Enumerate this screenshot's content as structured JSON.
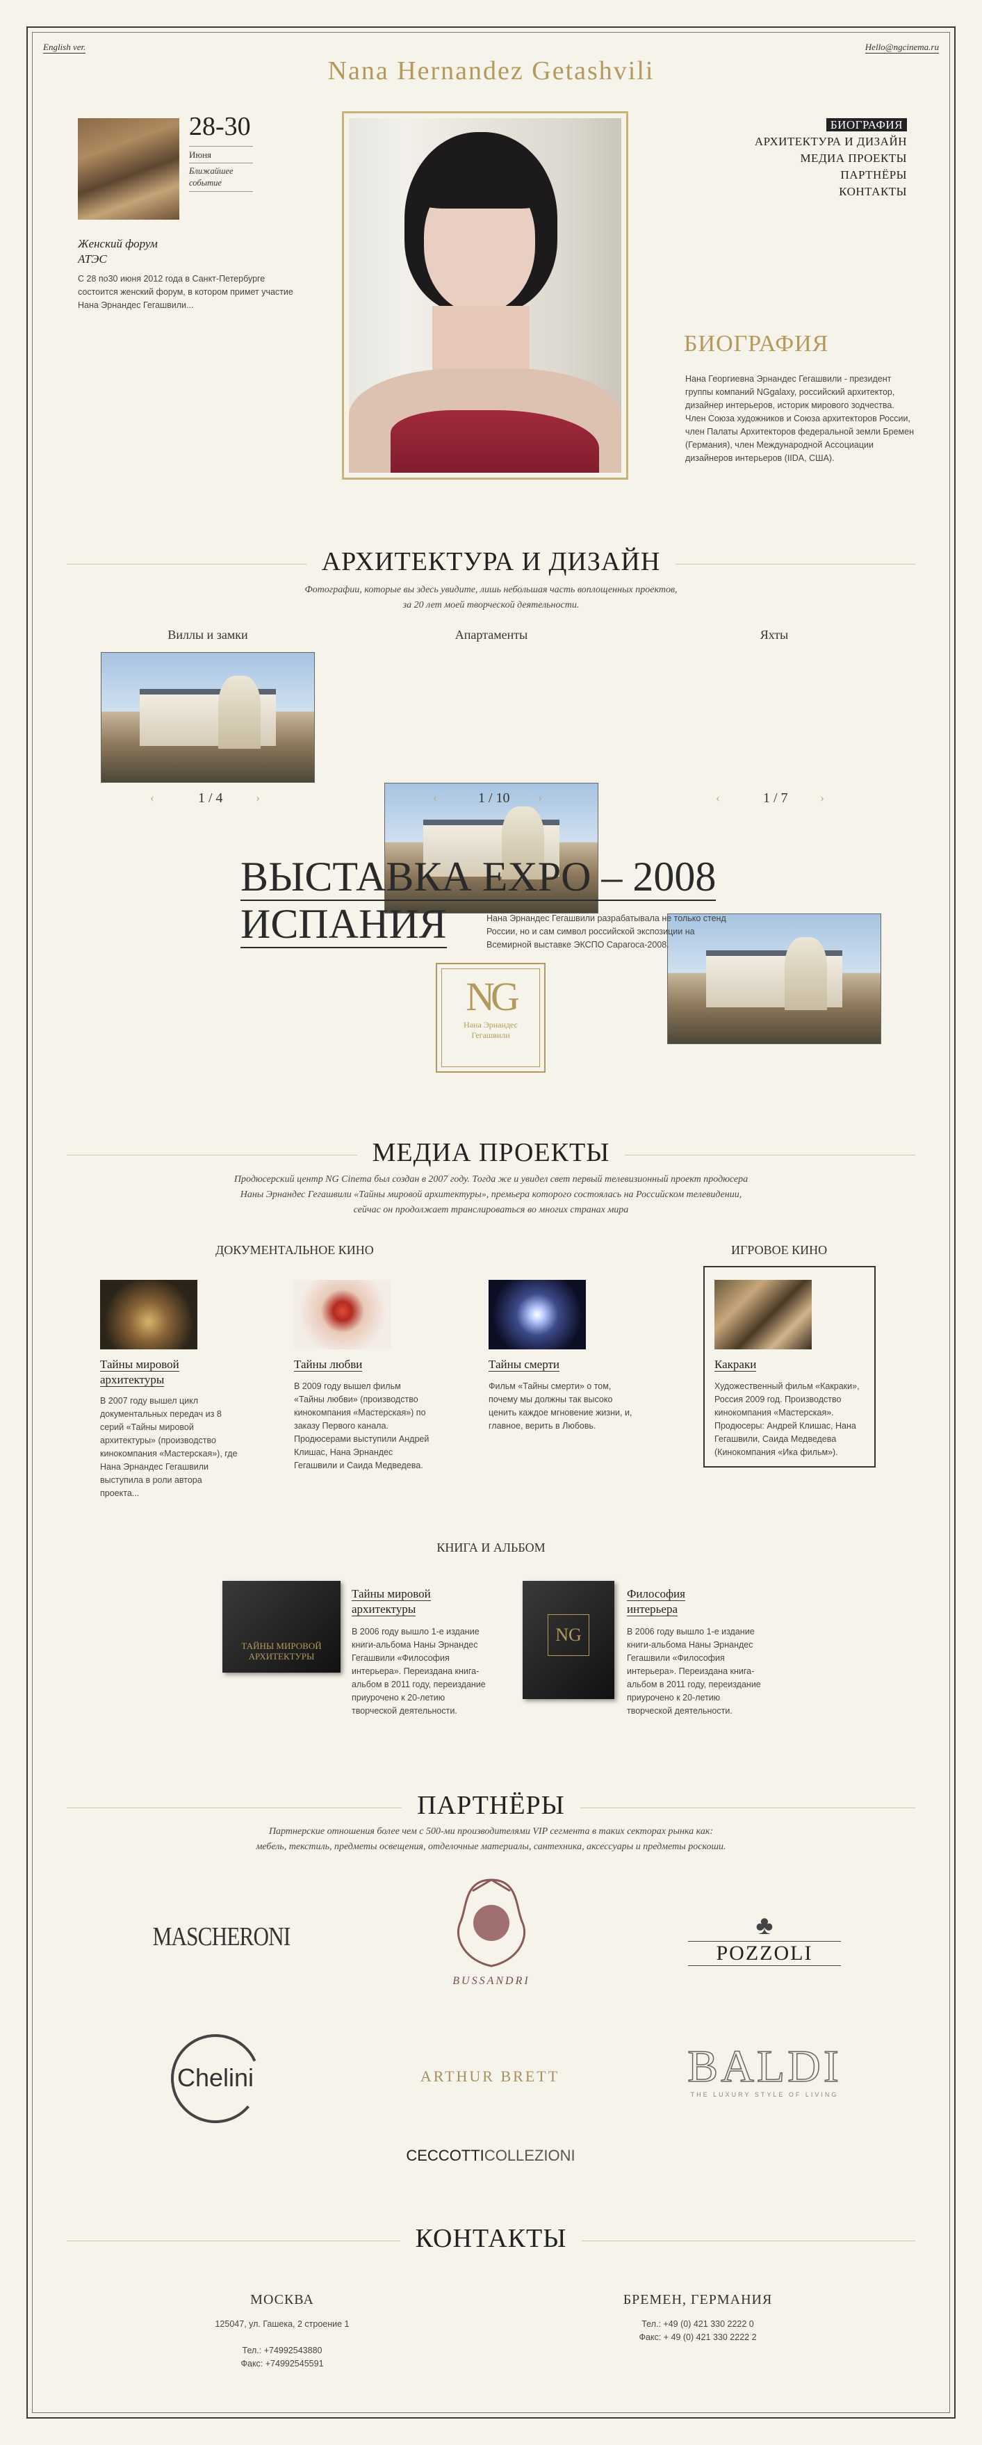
{
  "header": {
    "lang_link": "English ver.",
    "email": "Hello@ngcinema.ru",
    "title": "Nana Hernandez Getashvili"
  },
  "event": {
    "date": "28-30",
    "month": "Июня",
    "tag": "Ближайшее событие",
    "title": "Женский форум АТЭС",
    "text": "С 28 по30 июня 2012 года в Санкт-Петербурге состоится женский форум, в котором примет участие Нана Эрнандес Гегашвили..."
  },
  "menu": {
    "items": [
      "БИОГРАФИЯ",
      "АРХИТЕКТУРА И ДИЗАЙН",
      "МЕДИА ПРОЕКТЫ",
      "ПАРТНЁРЫ",
      "КОНТАКТЫ"
    ]
  },
  "bio": {
    "title": "БИОГРАФИЯ",
    "text": "Нана Георгиевна Эрнандес Гегашвили - президент группы компаний NGgalaxy, российский архитектор, дизайнер интерьеров, историк мирового зодчества. Член Союза художников и Союза архитекторов России, член Палаты Архитекторов федеральной земли Бремен (Германия), член Международной Ассоциации дизайнеров интерьеров (IIDA, США)."
  },
  "architecture": {
    "title": "АРХИТЕКТУРА И ДИЗАЙН",
    "subtitle_line1": "Фотографии, которые вы здесь увидите, лишь небольшая часть воплощенных проектов,",
    "subtitle_line2": "за 20 лет моей творческой деятельности.",
    "galleries": [
      {
        "caption": "Виллы и замки",
        "counter": "1 / 4"
      },
      {
        "caption": "Апартаменты",
        "counter": "1 / 10"
      },
      {
        "caption": "Яхты",
        "counter": "1 / 7"
      }
    ],
    "prev": "‹",
    "next": "›"
  },
  "expo": {
    "title_line1": "ВЫСТАВКА EXPO – 2008",
    "title_line2": "ИСПАНИЯ",
    "text": "Нана Эрнандес Гегашвили разрабатывала не только стенд России, но и сам символ российской экспозиции на Всемирной выставке ЭКСПО Сарагоса-2008.",
    "logo_letters": "NG",
    "logo_caption_1": "Нана Эрнандес",
    "logo_caption_2": "Гегашвили"
  },
  "media": {
    "title": "МЕДИА ПРОЕКТЫ",
    "subtitle_line1": "Продюсерский центр NG Cinema был создан в 2007 году. Тогда же и увидел свет первый телевизионный проект продюсера",
    "subtitle_line2": "Наны Эрнандес Гегашвили «Тайны мировой архитектуры», премьера которого состоялась на Российском телевидении,",
    "subtitle_line3": "сейчас он продолжает транслироваться во многих странах мира",
    "doc_heading": "ДОКУМЕНТАЛЬНОЕ КИНО",
    "game_heading": "ИГРОВОЕ КИНО",
    "films": [
      {
        "title": "Тайны мировой архитектуры",
        "text": "В 2007 году вышел цикл документальных передач из 8 серий «Тайны мировой архитектуры» (производство кинокомпания «Мастерская»), где Нана Эрнандес Гегашвили выступила в роли автора проекта..."
      },
      {
        "title": "Тайны любви",
        "text": "В 2009 году вышел фильм «Тайны любви» (производство кинокомпания «Мастерская») по заказу Первого канала. Продюсерами выступили Андрей Клишас, Нана Эрнандес Гегашвили и Саида Медведева."
      },
      {
        "title": "Тайны смерти",
        "text": "Фильм «Тайны смерти» о том, почему мы должны так высоко ценить каждое мгновение жизни, и, главное, верить в Любовь."
      },
      {
        "title": "Какраки",
        "text": "Художественный фильм «Какраки», Россия 2009 год. Производство кинокомпания «Мастерская». Продюсеры: Андрей Клишас, Нана Гегашвили, Саида Медведева (Кинокомпания «Ика фильм»)."
      }
    ],
    "books_heading": "КНИГА И АЛЬБОМ",
    "books": [
      {
        "title": "Тайны мировой архитектуры",
        "text": "В 2006 году вышло 1-е издание книги-альбома Наны Эрнандес Гегашвили «Философия интерьера». Переиздана книга-альбом в 2011 году, переиздание приурочено к 20-летию творческой деятельности.",
        "cover": "ТАЙНЫ МИРОВОЙ АРХИТЕКТУРЫ"
      },
      {
        "title": "Философия интерьера",
        "text": "В 2006 году вышло 1-е издание книги-альбома Наны Эрнандес Гегашвили «Философия интерьера». Переиздана книга-альбом в 2011 году, переиздание приурочено к 20-летию творческой деятельности.",
        "cover": "NG"
      }
    ]
  },
  "partners": {
    "title": "ПАРТНЁРЫ",
    "subtitle_line1": "Партнерские отношения более чем с 500-ми производителями VIP сегмента в таких секторах рынка как:",
    "subtitle_line2": "мебель, текстиль, предметы освещения, отделочные материалы, сантехника, аксессуары и предметы роскоши.",
    "logos": [
      "MASCHERONI",
      "BUSSANDRI",
      "POZZOLI",
      "Chelini",
      "ARTHUR BRETT",
      "BALDI",
      "CECCOTTI",
      "COLLEZIONI"
    ],
    "baldi_tag": "THE LUXURY STYLE OF LIVING"
  },
  "contacts": {
    "title": "КОНТАКТЫ",
    "moscow": {
      "city": "МОСКВА",
      "address": "125047, ул. Гашека, 2 строение 1",
      "phone": "Тел.: +74992543880",
      "fax": "Факс: +74992545591"
    },
    "bremen": {
      "city": "БРЕМЕН, ГЕРМАНИЯ",
      "phone": "Тел.: +49 (0) 421 330 2222 0",
      "fax": "Факс: + 49 (0) 421 330 2222 2"
    }
  },
  "colors": {
    "gold": "#b39a5c",
    "background": "#f6f4ea",
    "dark": "#222222"
  }
}
